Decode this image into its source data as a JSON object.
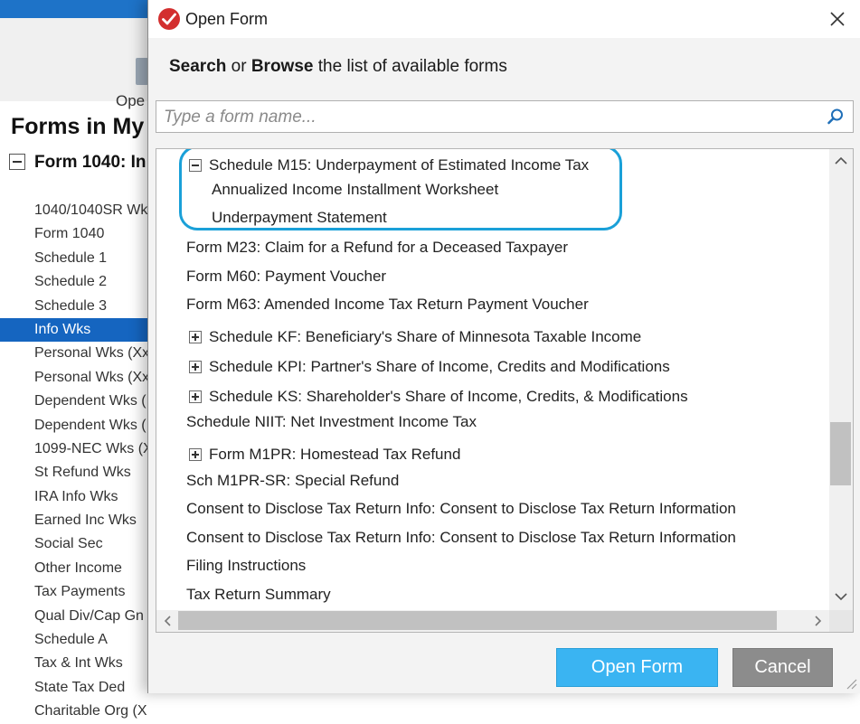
{
  "background_app": {
    "toolbar_open_label": "Ope",
    "forms_title": "Forms in My",
    "form_group_label": "Form 1040:  In",
    "form_list": [
      "1040/1040SR Wks",
      "Form 1040",
      "Schedule 1",
      "Schedule 2",
      "Schedule 3",
      "Info Wks",
      "Personal Wks (Xx",
      "Personal Wks (Xx",
      "Dependent Wks (",
      "Dependent Wks (",
      "1099-NEC Wks (X",
      "St Refund Wks",
      "IRA Info Wks",
      "Earned Inc Wks",
      "Social Sec",
      "Other Income",
      "Tax Payments",
      "Qual Div/Cap Gn",
      "Schedule A",
      "Tax & Int Wks",
      "State Tax Ded",
      "Charitable Org (X"
    ],
    "selected_item": "Info Wks"
  },
  "dialog": {
    "title": "Open Form",
    "instruction": {
      "search_word": "Search",
      "or_word": " or ",
      "browse_word": "Browse",
      "rest": " the list of available forms"
    },
    "search": {
      "placeholder": "Type a form name...",
      "value": ""
    },
    "forms": [
      {
        "label": "Schedule M15: Underpayment of Estimated Income Tax",
        "expander": "minus",
        "level": 1
      },
      {
        "label": "Annualized Income Installment Worksheet",
        "expander": "",
        "level": 2
      },
      {
        "label": "Underpayment Statement",
        "expander": "",
        "level": 2
      },
      {
        "label": "Form M23: Claim for a Refund for a Deceased Taxpayer",
        "expander": "",
        "level": 0
      },
      {
        "label": "Form M60: Payment Voucher",
        "expander": "",
        "level": 0
      },
      {
        "label": "Form M63: Amended Income Tax Return Payment Voucher",
        "expander": "",
        "level": 0
      },
      {
        "label": "Schedule KF: Beneficiary's Share of Minnesota Taxable Income",
        "expander": "plus",
        "level": 1
      },
      {
        "label": "Schedule KPI: Partner's Share of Income, Credits and Modifications",
        "expander": "plus",
        "level": 1
      },
      {
        "label": "Schedule KS: Shareholder's Share of Income, Credits, & Modifications",
        "expander": "plus",
        "level": 1
      },
      {
        "label": "Schedule NIIT: Net Investment Income Tax",
        "expander": "",
        "level": 0
      },
      {
        "label": "Form M1PR: Homestead Tax Refund",
        "expander": "plus",
        "level": 1
      },
      {
        "label": "Sch M1PR-SR: Special Refund",
        "expander": "",
        "level": 0
      },
      {
        "label": "Consent to Disclose Tax Return Info: Consent to Disclose Tax Return Information",
        "expander": "",
        "level": 0
      },
      {
        "label": "Consent to Disclose Tax Return Info: Consent to Disclose Tax Return Information",
        "expander": "",
        "level": 0
      },
      {
        "label": "Filing Instructions",
        "expander": "",
        "level": 0
      },
      {
        "label": "Tax Return Summary",
        "expander": "",
        "level": 0
      }
    ],
    "open_button_label": "Open Form",
    "cancel_button_label": "Cancel"
  },
  "colors": {
    "highlight_ring": "#1aa0d8",
    "open_button": "#3ab4f2",
    "cancel_button": "#8c8c8c",
    "selected_background": "#1565c0",
    "title_icon": "#d32f2f"
  },
  "icons": {
    "title": "red-checkmark-icon",
    "close": "close-icon",
    "search": "search-icon"
  }
}
